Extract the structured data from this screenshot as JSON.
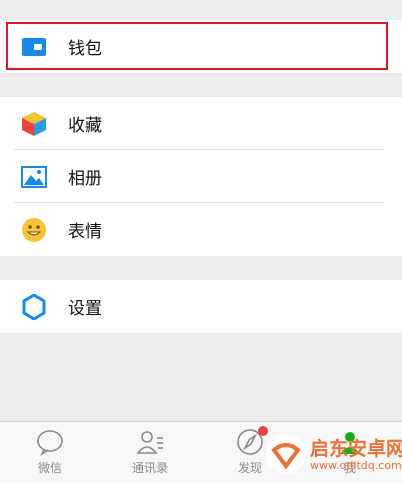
{
  "menu": {
    "wallet": {
      "label": "钱包",
      "icon": "wallet-icon"
    },
    "favorites": {
      "label": "收藏",
      "icon": "cube-icon"
    },
    "album": {
      "label": "相册",
      "icon": "image-icon"
    },
    "stickers": {
      "label": "表情",
      "icon": "smiley-icon"
    },
    "settings": {
      "label": "设置",
      "icon": "gear-icon"
    }
  },
  "tabbar": {
    "chats": {
      "label": "微信",
      "icon": "chat-bubble-icon"
    },
    "contacts": {
      "label": "通讯录",
      "icon": "contacts-icon"
    },
    "discover": {
      "label": "发现",
      "icon": "compass-icon",
      "has_badge": true
    },
    "me": {
      "label": "我",
      "icon": "person-icon"
    }
  },
  "watermark": {
    "name": "启东安卓网",
    "url": "www.qdltdq.com"
  },
  "colors": {
    "accent_blue": "#1a8ae6",
    "highlight_red": "#d11a2a",
    "badge_red": "#e64340",
    "background": "#ededed"
  }
}
